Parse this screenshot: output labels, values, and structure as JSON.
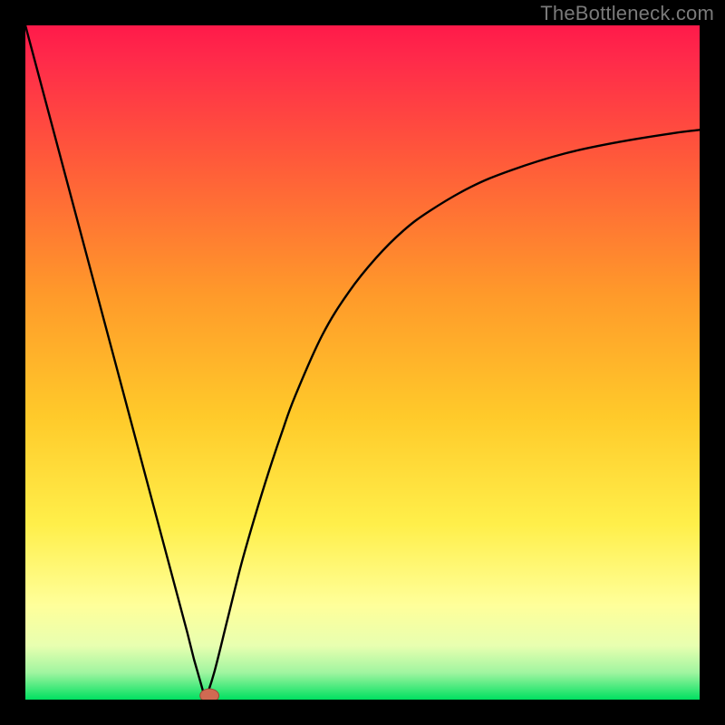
{
  "watermark": "TheBottleneck.com",
  "colors": {
    "background": "#000000",
    "gradient_top": "#ff1a4a",
    "gradient_mid_upper": "#ff7a2a",
    "gradient_mid": "#ffd93a",
    "gradient_lower": "#ffff8a",
    "gradient_bottom": "#00e060",
    "curve": "#000000",
    "marker_fill": "#d06a52",
    "marker_stroke": "#9a4a38"
  },
  "chart_data": {
    "type": "line",
    "title": "",
    "xlabel": "",
    "ylabel": "",
    "xlim": [
      0,
      100
    ],
    "ylim": [
      0,
      100
    ],
    "grid": false,
    "legend": false,
    "series": [
      {
        "name": "left-branch",
        "x": [
          0,
          2,
          4,
          6,
          8,
          10,
          12,
          14,
          16,
          18,
          20,
          22,
          24,
          25,
          26,
          26.7
        ],
        "y": [
          100,
          92.5,
          85,
          77.5,
          70,
          62.5,
          55,
          47.5,
          40,
          32.5,
          25,
          17.5,
          10,
          6,
          2.5,
          0
        ]
      },
      {
        "name": "right-branch",
        "x": [
          26.7,
          28,
          30,
          32,
          34,
          36,
          38,
          40,
          44,
          48,
          52,
          56,
          60,
          66,
          72,
          80,
          88,
          96,
          100
        ],
        "y": [
          0,
          4,
          12,
          20,
          27,
          33.5,
          39.5,
          45,
          54,
          60.5,
          65.5,
          69.5,
          72.5,
          76,
          78.5,
          81,
          82.7,
          84,
          84.5
        ]
      }
    ],
    "marker": {
      "x": 27.3,
      "y": 0.6,
      "rx": 1.4,
      "ry": 1.0
    },
    "gradient_stops": [
      {
        "offset": 0.0,
        "color": "#ff1a4a"
      },
      {
        "offset": 0.05,
        "color": "#ff2a4a"
      },
      {
        "offset": 0.2,
        "color": "#ff5a3a"
      },
      {
        "offset": 0.4,
        "color": "#ff9a2a"
      },
      {
        "offset": 0.58,
        "color": "#ffca2a"
      },
      {
        "offset": 0.74,
        "color": "#ffef4a"
      },
      {
        "offset": 0.86,
        "color": "#ffff9a"
      },
      {
        "offset": 0.92,
        "color": "#e8ffb0"
      },
      {
        "offset": 0.96,
        "color": "#a0f5a0"
      },
      {
        "offset": 1.0,
        "color": "#00e060"
      }
    ]
  }
}
